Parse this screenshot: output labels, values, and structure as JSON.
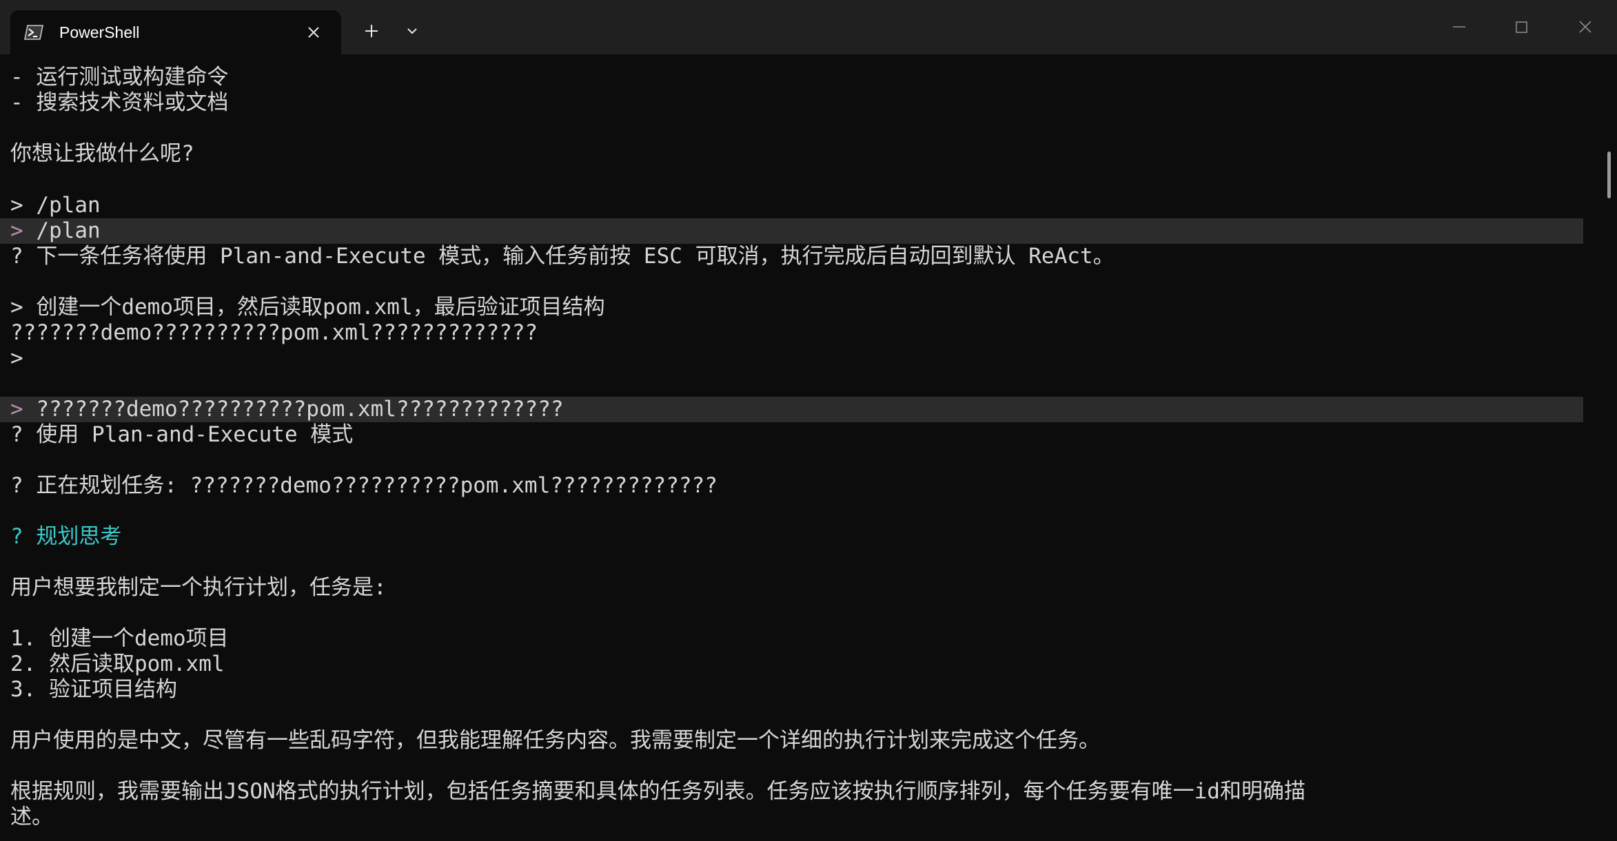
{
  "window": {
    "tab_title": "PowerShell",
    "tab_icon": "powershell-icon",
    "new_tab_icon": "plus-icon",
    "dropdown_icon": "chevron-down-icon",
    "controls": [
      "minimize-icon",
      "maximize-icon",
      "close-icon"
    ]
  },
  "colors": {
    "background": "#0c0c0c",
    "titlebar": "#202020",
    "text": "#d6d6d6",
    "highlight_band": "#2c2c2c",
    "prompt_accent": "#b48ead",
    "cyan": "#3ac8c8"
  },
  "terminal": {
    "lines": {
      "l01": "- 运行测试或构建命令",
      "l02": "- 搜索技术资料或文档",
      "l03": "你想让我做什么呢?",
      "l04": "> /plan",
      "l05_prompt": ">",
      "l05_text": " /plan",
      "l06": "? 下一条任务将使用 Plan-and-Execute 模式，输入任务前按 ESC 可取消，执行完成后自动回到默认 ReAct。",
      "l07": "> 创建一个demo项目，然后读取pom.xml，最后验证项目结构",
      "l08": "???????demo??????????pom.xml?????????????",
      "l09": ">",
      "l10_prompt": ">",
      "l10_text": " ???????demo??????????pom.xml?????????????",
      "l11": "? 使用 Plan-and-Execute 模式",
      "l12": "? 正在规划任务: ???????demo??????????pom.xml?????????????",
      "l13": "? 规划思考",
      "l14": "用户想要我制定一个执行计划，任务是:",
      "l15": "1. 创建一个demo项目",
      "l16": "2. 然后读取pom.xml",
      "l17": "3. 验证项目结构",
      "l18": "用户使用的是中文，尽管有一些乱码字符，但我能理解任务内容。我需要制定一个详细的执行计划来完成这个任务。",
      "l19": "根据规则，我需要输出JSON格式的执行计划，包括任务摘要和具体的任务列表。任务应该按执行顺序排列，每个任务要有唯一id和明确描",
      "l20": "述。"
    }
  }
}
